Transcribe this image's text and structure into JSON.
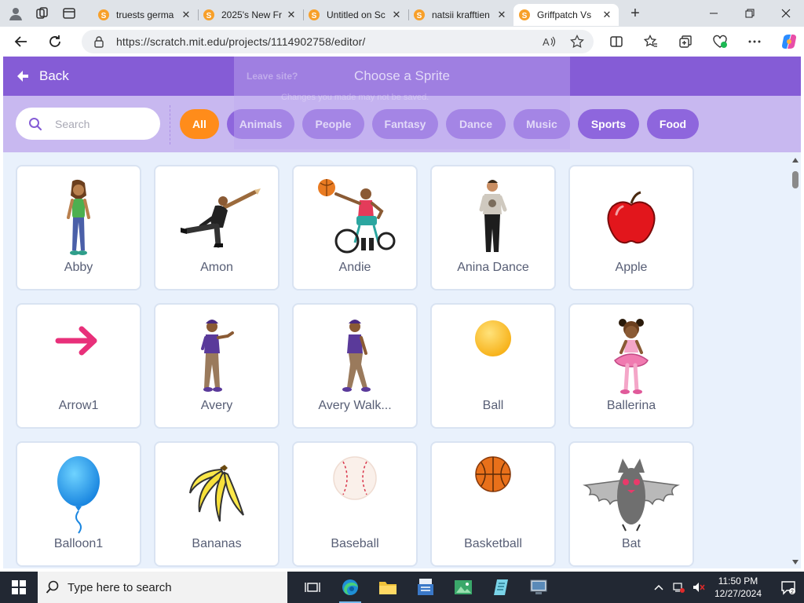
{
  "browser": {
    "tabs": [
      {
        "title": "truests germa",
        "active": false
      },
      {
        "title": "2025's New Fr",
        "active": false
      },
      {
        "title": "Untitled on Sc",
        "active": false
      },
      {
        "title": "natsii krafftien",
        "active": false
      },
      {
        "title": "Griffpatch Vs",
        "active": true
      }
    ],
    "new_tab": "+",
    "url": "https://scratch.mit.edu/projects/1114902758/editor/"
  },
  "scratch": {
    "back_label": "Back",
    "title": "Choose a Sprite",
    "ghost_dialog": {
      "title": "Leave site?",
      "text": "Changes you made may not be saved."
    },
    "search": {
      "placeholder": "Search",
      "value": ""
    },
    "tags": [
      {
        "label": "All",
        "active": true
      },
      {
        "label": "Animals",
        "active": false
      },
      {
        "label": "People",
        "active": false
      },
      {
        "label": "Fantasy",
        "active": false
      },
      {
        "label": "Dance",
        "active": false
      },
      {
        "label": "Music",
        "active": false
      },
      {
        "label": "Sports",
        "active": false
      },
      {
        "label": "Food",
        "active": false
      }
    ],
    "sprites": [
      {
        "name": "Abby",
        "icon": "girl-standing-icon"
      },
      {
        "name": "Amon",
        "icon": "dancer-man-icon"
      },
      {
        "name": "Andie",
        "icon": "wheelchair-basketball-icon"
      },
      {
        "name": "Anina Dance",
        "icon": "dancer-woman-icon"
      },
      {
        "name": "Apple",
        "icon": "apple-icon"
      },
      {
        "name": "Arrow1",
        "icon": "arrow-icon"
      },
      {
        "name": "Avery",
        "icon": "girl-waving-icon"
      },
      {
        "name": "Avery Walk...",
        "icon": "girl-walking-icon"
      },
      {
        "name": "Ball",
        "icon": "ball-icon"
      },
      {
        "name": "Ballerina",
        "icon": "ballerina-icon"
      },
      {
        "name": "Balloon1",
        "icon": "balloon-icon"
      },
      {
        "name": "Bananas",
        "icon": "bananas-icon"
      },
      {
        "name": "Baseball",
        "icon": "baseball-icon"
      },
      {
        "name": "Basketball",
        "icon": "basketball-icon"
      },
      {
        "name": "Bat",
        "icon": "bat-icon"
      }
    ]
  },
  "taskbar": {
    "search_placeholder": "Type here to search",
    "time": "11:50 PM",
    "date": "12/27/2024"
  },
  "colors": {
    "scratch_purple": "#855cd6",
    "tag_purple": "#8e66dd",
    "tag_active": "#ff8c1a",
    "library_bg": "#e9f1fc"
  }
}
